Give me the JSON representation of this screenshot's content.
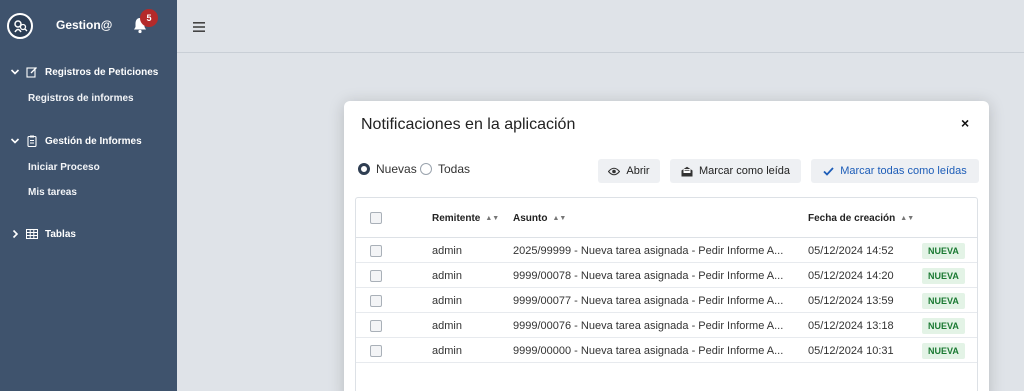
{
  "app": {
    "brand": "Gestion@",
    "notification_count": "5"
  },
  "sidebar": {
    "groups": [
      {
        "label": "Registros de Peticiones",
        "items": [
          "Registros de informes"
        ]
      },
      {
        "label": "Gestión de Informes",
        "items": [
          "Iniciar Proceso",
          "Mis tareas"
        ]
      },
      {
        "label": "Tablas",
        "items": []
      }
    ]
  },
  "modal": {
    "title": "Notificaciones en la aplicación",
    "close": "×",
    "filters": {
      "new": "Nuevas",
      "all": "Todas",
      "selected": "Nuevas"
    },
    "buttons": {
      "open": "Abrir",
      "mark_read": "Marcar como leída",
      "mark_all_read": "Marcar todas como leídas"
    },
    "table": {
      "columns": [
        "Remitente",
        "Asunto",
        "Fecha de creación"
      ],
      "rows": [
        {
          "sender": "admin",
          "subject": "2025/99999 - Nueva tarea asignada - Pedir Informe A...",
          "date": "05/12/2024 14:52",
          "status": "NUEVA"
        },
        {
          "sender": "admin",
          "subject": "9999/00078 - Nueva tarea asignada - Pedir Informe A...",
          "date": "05/12/2024 14:20",
          "status": "NUEVA"
        },
        {
          "sender": "admin",
          "subject": "9999/00077 - Nueva tarea asignada - Pedir Informe A...",
          "date": "05/12/2024 13:59",
          "status": "NUEVA"
        },
        {
          "sender": "admin",
          "subject": "9999/00076 - Nueva tarea asignada - Pedir Informe A...",
          "date": "05/12/2024 13:18",
          "status": "NUEVA"
        },
        {
          "sender": "admin",
          "subject": "9999/00000 - Nueva tarea asignada - Pedir Informe A...",
          "date": "05/12/2024 10:31",
          "status": "NUEVA"
        }
      ]
    }
  },
  "colors": {
    "sidebar": "#3f536d",
    "badge": "#b42a2a",
    "primary_text": "#1d5db8",
    "new_badge_bg": "#e3f3e6",
    "new_badge_text": "#1b7a33"
  },
  "icons": [
    "logo-icon",
    "bell-icon",
    "menu-icon",
    "edit-icon",
    "clipboard-icon",
    "table-icon",
    "eye-icon",
    "envelope-open-icon",
    "check-icon",
    "close-icon"
  ]
}
